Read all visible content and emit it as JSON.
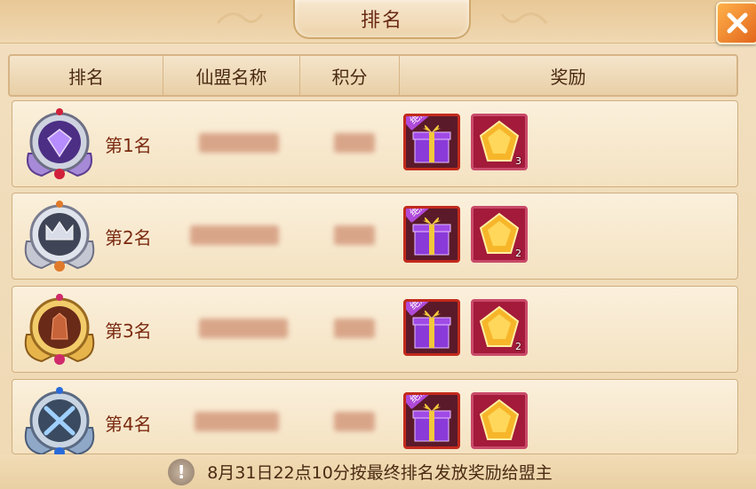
{
  "window": {
    "title": "排名",
    "close_icon": "close-x-icon"
  },
  "table": {
    "headers": [
      "排名",
      "仙盟名称",
      "积分",
      "奖励"
    ],
    "rows": [
      {
        "rank_label": "第1名",
        "medal_icon": "purple-diamond-medal-icon",
        "gift_badge": "绝版",
        "gem_count": "3"
      },
      {
        "rank_label": "第2名",
        "medal_icon": "silver-crown-medal-icon",
        "gift_badge": "绝版",
        "gem_count": "2"
      },
      {
        "rank_label": "第3名",
        "medal_icon": "bronze-fist-medal-icon",
        "gift_badge": "绝版",
        "gem_count": "2"
      },
      {
        "rank_label": "第4名",
        "medal_icon": "blue-swords-medal-icon",
        "gift_badge": "绝版",
        "gem_count": ""
      }
    ]
  },
  "footer": {
    "notice_icon": "exclamation-icon",
    "notice_text": "8月31日22点10分按最终排名发放奖励给盟主"
  },
  "colors": {
    "panel_bg": "#f2dfbf",
    "title_text": "#6b2a14",
    "rank_text": "#7a2a10",
    "close_button": "#e2651c",
    "reward_border": "#c22a1c"
  }
}
